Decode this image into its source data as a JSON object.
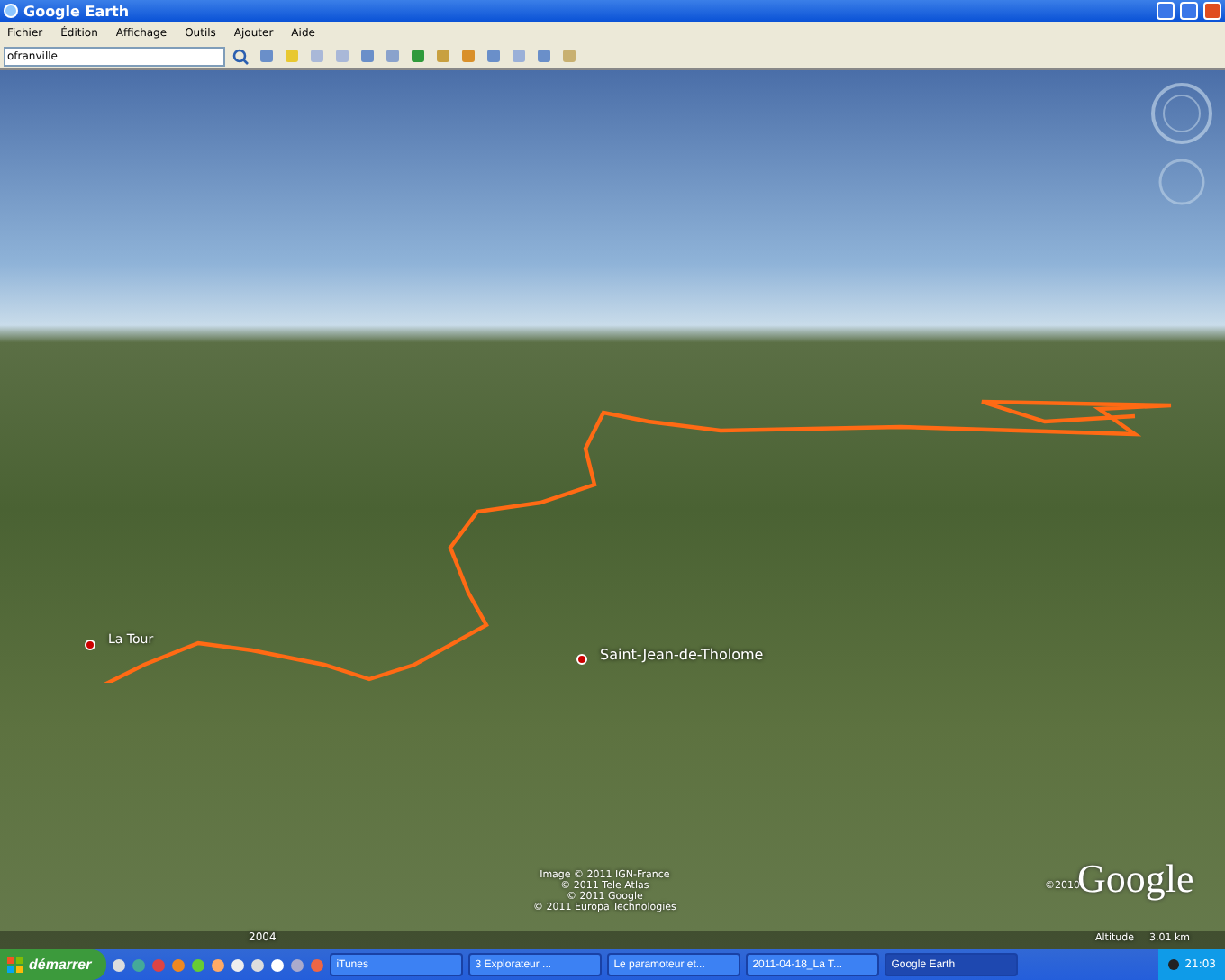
{
  "window": {
    "title": "Google Earth"
  },
  "menu": [
    "Fichier",
    "Édition",
    "Affichage",
    "Outils",
    "Ajouter",
    "Aide"
  ],
  "search": {
    "value": "ofranville"
  },
  "map": {
    "places": [
      {
        "name": "La Tour",
        "kind": "pin"
      },
      {
        "name": "Saint-Jean-de-Tholome",
        "kind": "pin"
      }
    ],
    "attribution": [
      "Image © 2011 IGN-France",
      "© 2011 Tele Atlas",
      "© 2011 Google",
      "© 2011 Europa Technologies"
    ],
    "copyright": "©2010",
    "logo": "Google",
    "year": "2004",
    "altitude_label": "Altitude",
    "altitude_value": "3.01 km"
  },
  "taskbar": {
    "start": "démarrer",
    "tasks": [
      {
        "label": "iTunes",
        "selected": false
      },
      {
        "label": "3 Explorateur ...",
        "selected": false
      },
      {
        "label": "Le paramoteur et...",
        "selected": false
      },
      {
        "label": "2011-04-18_La T...",
        "selected": false
      },
      {
        "label": "Google Earth",
        "selected": true
      }
    ],
    "clock": "21:03"
  }
}
